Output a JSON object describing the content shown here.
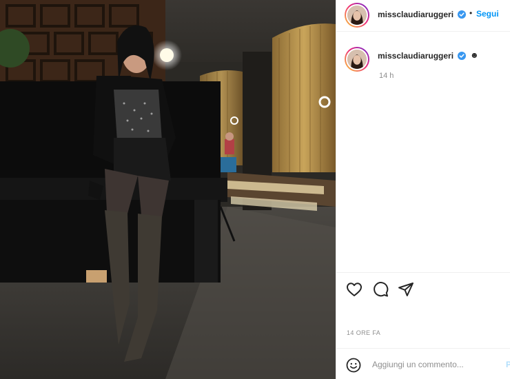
{
  "post": {
    "photo_icon": "photo-image",
    "username": "missclaudiaruggeri",
    "verified_icon": "verified-badge-icon",
    "separator": "•",
    "follow_label": "Segui"
  },
  "caption": {
    "username": "missclaudiaruggeri",
    "text": "☻",
    "age": "14 h"
  },
  "actions": {
    "like_icon": "heart-icon",
    "comment_icon": "comment-bubble-icon",
    "share_icon": "paper-plane-icon"
  },
  "timestamp": "14 ORE FA",
  "comment_box": {
    "emoji_icon": "smiley-icon",
    "placeholder": "Aggiungi un commento...",
    "post_label": "P"
  },
  "colors": {
    "accent": "#0095f6",
    "verified": "#3897f0",
    "muted": "#8e8e8e",
    "text": "#262626"
  }
}
